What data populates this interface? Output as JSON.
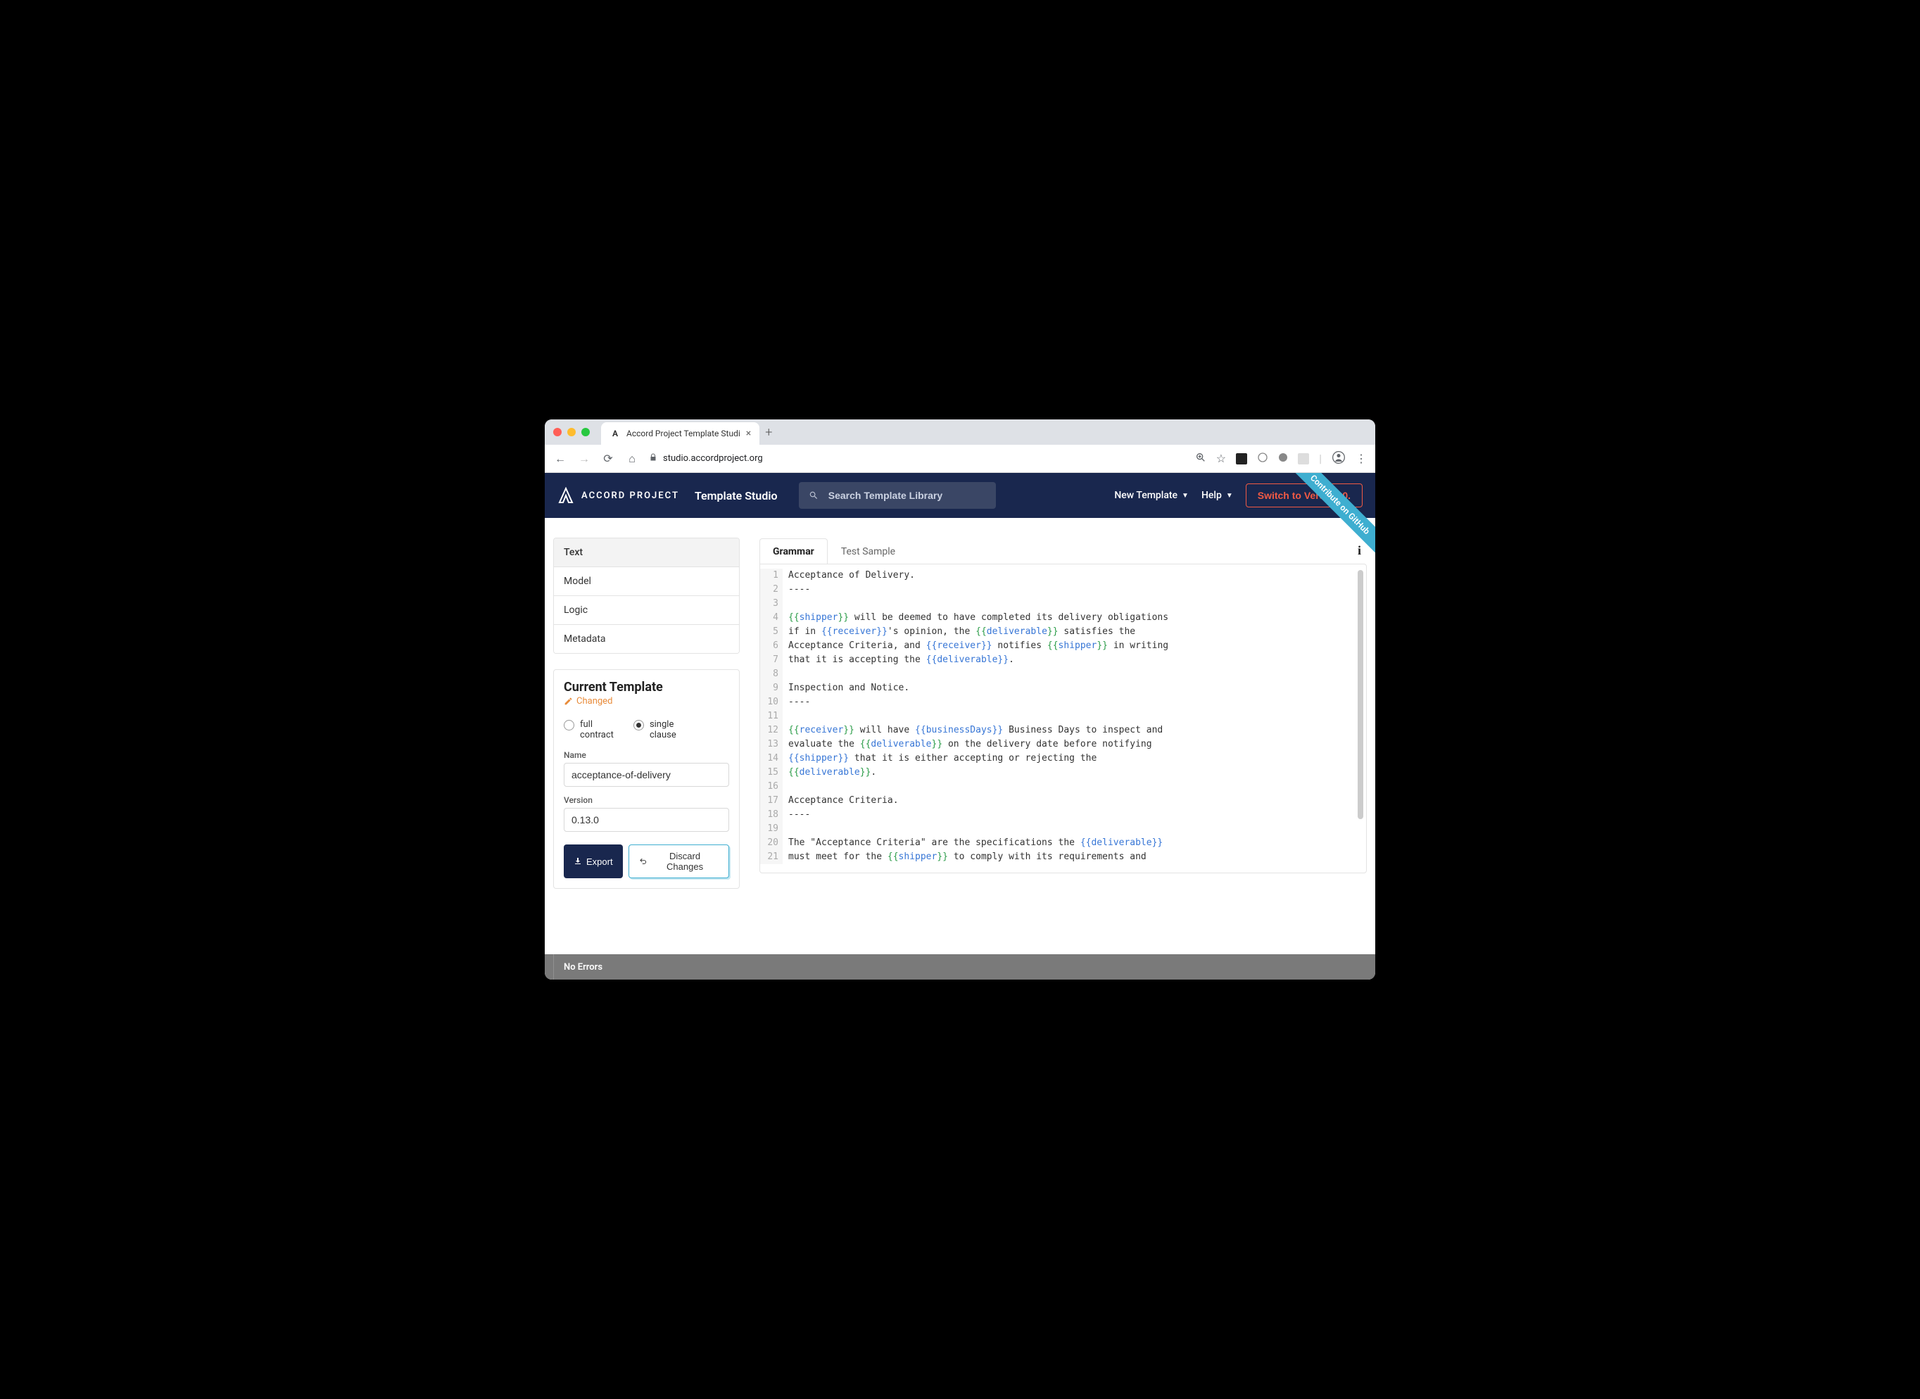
{
  "browser": {
    "tab_title": "Accord Project Template Studi",
    "url_host": "studio.accordproject.org",
    "favicon_letter": "A"
  },
  "header": {
    "brand": "ACCORD PROJECT",
    "app_name": "Template Studio",
    "search_placeholder": "Search Template Library",
    "new_template": "New Template",
    "help": "Help",
    "switch_label": "Switch to Version 0.",
    "ribbon": "Contribute on GitHub"
  },
  "sidebar": {
    "tabs": {
      "text": "Text",
      "model": "Model",
      "logic": "Logic",
      "metadata": "Metadata"
    },
    "current_template": {
      "heading": "Current Template",
      "changed": "Changed",
      "radio_full_l1": "full",
      "radio_full_l2": "contract",
      "radio_single_l1": "single",
      "radio_single_l2": "clause",
      "name_label": "Name",
      "name_value": "acceptance-of-delivery",
      "version_label": "Version",
      "version_value": "0.13.0",
      "export": "Export",
      "discard": "Discard Changes"
    }
  },
  "editor": {
    "tab_grammar": "Grammar",
    "tab_sample": "Test Sample",
    "lines": [
      {
        "n": "1",
        "t": [
          {
            "s": "Acceptance of Delivery."
          }
        ]
      },
      {
        "n": "2",
        "t": [
          {
            "s": "----"
          }
        ]
      },
      {
        "n": "3",
        "t": []
      },
      {
        "n": "4",
        "t": [
          {
            "s": "{{",
            "c": "g"
          },
          {
            "s": "shipper",
            "c": "v"
          },
          {
            "s": "}}",
            "c": "g"
          },
          {
            "s": " will be deemed to have completed its delivery obligations"
          }
        ]
      },
      {
        "n": "5",
        "t": [
          {
            "s": "if in "
          },
          {
            "s": "{{",
            "c": "b"
          },
          {
            "s": "receiver",
            "c": "v"
          },
          {
            "s": "}}",
            "c": "b"
          },
          {
            "s": "'s opinion, the "
          },
          {
            "s": "{{",
            "c": "g"
          },
          {
            "s": "deliverable",
            "c": "v"
          },
          {
            "s": "}}",
            "c": "g"
          },
          {
            "s": " satisfies the"
          }
        ]
      },
      {
        "n": "6",
        "t": [
          {
            "s": "Acceptance Criteria, and "
          },
          {
            "s": "{{",
            "c": "b"
          },
          {
            "s": "receiver",
            "c": "v"
          },
          {
            "s": "}}",
            "c": "b"
          },
          {
            "s": " notifies "
          },
          {
            "s": "{{",
            "c": "g"
          },
          {
            "s": "shipper",
            "c": "v"
          },
          {
            "s": "}}",
            "c": "g"
          },
          {
            "s": " in writing"
          }
        ]
      },
      {
        "n": "7",
        "t": [
          {
            "s": "that it is accepting the "
          },
          {
            "s": "{{",
            "c": "b"
          },
          {
            "s": "deliverable",
            "c": "v"
          },
          {
            "s": "}}",
            "c": "b"
          },
          {
            "s": "."
          }
        ]
      },
      {
        "n": "8",
        "t": []
      },
      {
        "n": "9",
        "t": [
          {
            "s": "Inspection and Notice."
          }
        ]
      },
      {
        "n": "10",
        "t": [
          {
            "s": "----"
          }
        ]
      },
      {
        "n": "11",
        "t": []
      },
      {
        "n": "12",
        "t": [
          {
            "s": "{{",
            "c": "g"
          },
          {
            "s": "receiver",
            "c": "v"
          },
          {
            "s": "}}",
            "c": "g"
          },
          {
            "s": " will have "
          },
          {
            "s": "{{",
            "c": "b"
          },
          {
            "s": "businessDays",
            "c": "v"
          },
          {
            "s": "}}",
            "c": "b"
          },
          {
            "s": " Business Days to inspect and"
          }
        ]
      },
      {
        "n": "13",
        "t": [
          {
            "s": "evaluate the "
          },
          {
            "s": "{{",
            "c": "g"
          },
          {
            "s": "deliverable",
            "c": "v"
          },
          {
            "s": "}}",
            "c": "g"
          },
          {
            "s": " on the delivery date before notifying"
          }
        ]
      },
      {
        "n": "14",
        "t": [
          {
            "s": "{{",
            "c": "b"
          },
          {
            "s": "shipper",
            "c": "v"
          },
          {
            "s": "}}",
            "c": "b"
          },
          {
            "s": " that it is either accepting or rejecting the"
          }
        ]
      },
      {
        "n": "15",
        "t": [
          {
            "s": "{{",
            "c": "g"
          },
          {
            "s": "deliverable",
            "c": "v"
          },
          {
            "s": "}}",
            "c": "g"
          },
          {
            "s": "."
          }
        ]
      },
      {
        "n": "16",
        "t": []
      },
      {
        "n": "17",
        "t": [
          {
            "s": "Acceptance Criteria."
          }
        ]
      },
      {
        "n": "18",
        "t": [
          {
            "s": "----"
          }
        ]
      },
      {
        "n": "19",
        "t": []
      },
      {
        "n": "20",
        "t": [
          {
            "s": "The \"Acceptance Criteria\" are the specifications the "
          },
          {
            "s": "{{",
            "c": "b"
          },
          {
            "s": "deliverable",
            "c": "v"
          },
          {
            "s": "}}",
            "c": "b"
          }
        ]
      },
      {
        "n": "21",
        "t": [
          {
            "s": "must meet for the "
          },
          {
            "s": "{{",
            "c": "g"
          },
          {
            "s": "shipper",
            "c": "v"
          },
          {
            "s": "}}",
            "c": "g"
          },
          {
            "s": " to comply with its requirements and"
          }
        ]
      }
    ]
  },
  "status": {
    "text": "No Errors"
  }
}
